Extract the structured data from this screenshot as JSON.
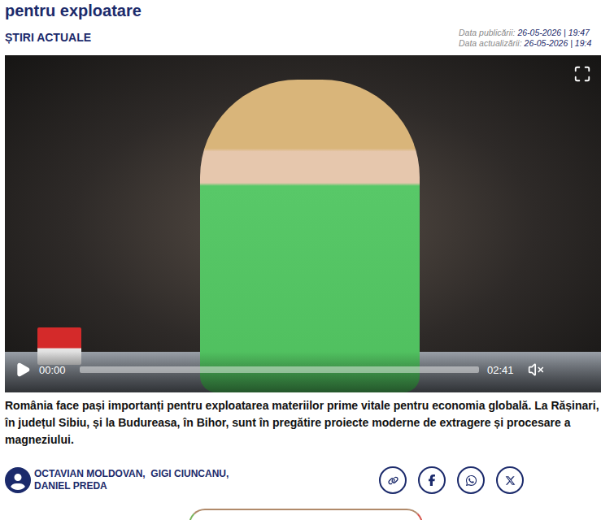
{
  "article": {
    "title": "pentru exploatare",
    "category": "ȘTIRI ACTUALE",
    "dates": [
      {
        "label": "Data publicării:",
        "value": "26-05-2026 | 19:47"
      },
      {
        "label": "Data actualizării:",
        "value": "26-05-2026 | 19:4"
      }
    ]
  },
  "video": {
    "time_current": "00:00",
    "duration": "02:41",
    "level": 0,
    "playing": false,
    "muted": true
  },
  "lead": "România face pași importanți pentru exploatarea materiilor prime vitale pentru economia globală. La Rășinari, în județul Sibiu, și la Budureasa, în Bihor, sunt în pregătire proiecte moderne de extragere și procesare a magneziului.",
  "authors": [
    "OCTAVIAN MOLDOVAN,  GIGI CIUNCANU,",
    "DANIEL PREDA"
  ],
  "share": [
    {
      "kind": "link"
    },
    {
      "kind": "facebook"
    },
    {
      "kind": "whatsapp"
    },
    {
      "kind": "x"
    }
  ]
}
